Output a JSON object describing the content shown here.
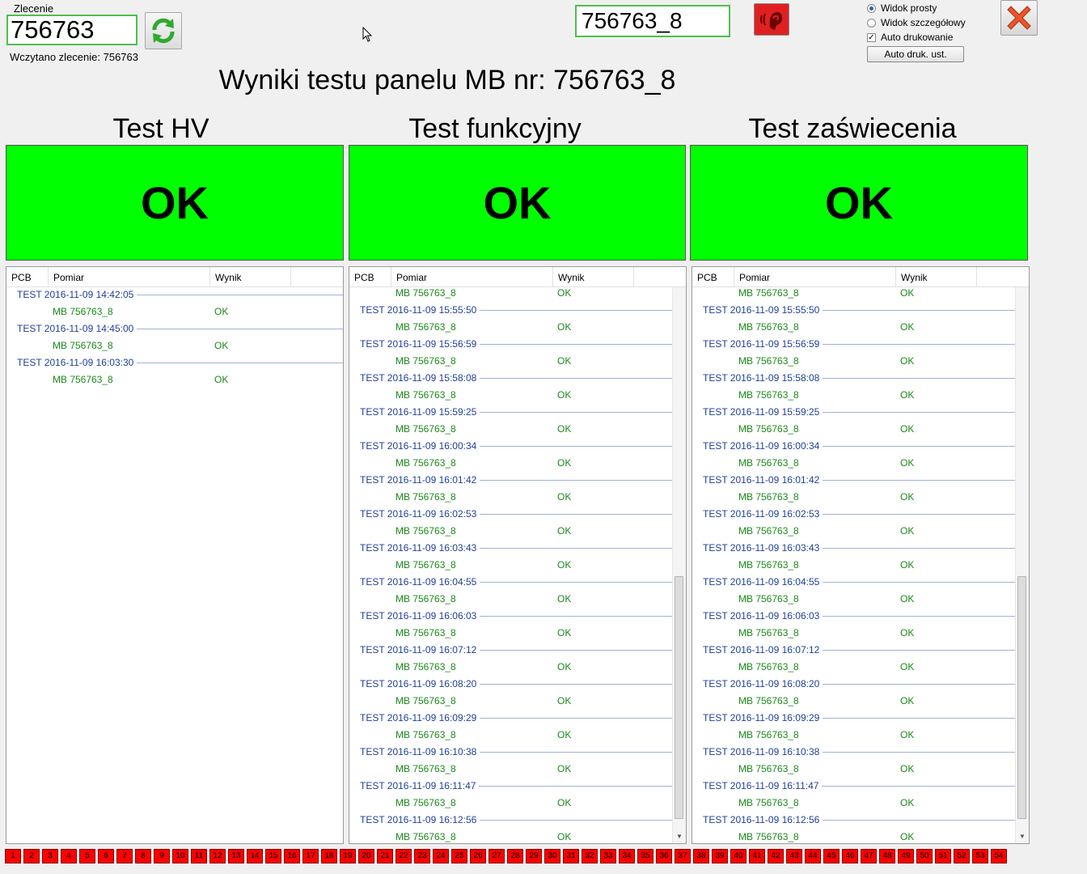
{
  "order": {
    "label": "Zlecenie",
    "value": "756763",
    "loaded_text": "Wczytano zlecenie: 756763"
  },
  "panel_input": {
    "value": "756763_8"
  },
  "options": {
    "simple_view": "Widok prosty",
    "detailed_view": "Widok szczegółowy",
    "auto_print": "Auto drukowanie",
    "auto_print_settings": "Auto druk. ust."
  },
  "title": "Wyniki testu panelu MB nr: 756763_8",
  "columns": [
    {
      "title": "Test HV",
      "status": "OK"
    },
    {
      "title": "Test funkcyjny",
      "status": "OK"
    },
    {
      "title": "Test zaświecenia",
      "status": "OK"
    }
  ],
  "list_headers": {
    "pcb": "PCB",
    "measurement": "Pomiar",
    "result": "Wynik"
  },
  "hv_list": {
    "groups": [
      {
        "label": "TEST 2016-11-09 14:42:05",
        "item": "MB 756763_8",
        "result": "OK"
      },
      {
        "label": "TEST 2016-11-09 14:45:00",
        "item": "MB 756763_8",
        "result": "OK"
      },
      {
        "label": "TEST 2016-11-09 16:03:30",
        "item": "MB 756763_8",
        "result": "OK"
      }
    ]
  },
  "scroll_list": {
    "top_item": "MB 756763_8",
    "top_result": "OK",
    "groups": [
      {
        "label": "TEST 2016-11-09 15:55:50",
        "item": "MB 756763_8",
        "result": "OK"
      },
      {
        "label": "TEST 2016-11-09 15:56:59",
        "item": "MB 756763_8",
        "result": "OK"
      },
      {
        "label": "TEST 2016-11-09 15:58:08",
        "item": "MB 756763_8",
        "result": "OK"
      },
      {
        "label": "TEST 2016-11-09 15:59:25",
        "item": "MB 756763_8",
        "result": "OK"
      },
      {
        "label": "TEST 2016-11-09 16:00:34",
        "item": "MB 756763_8",
        "result": "OK"
      },
      {
        "label": "TEST 2016-11-09 16:01:42",
        "item": "MB 756763_8",
        "result": "OK"
      },
      {
        "label": "TEST 2016-11-09 16:02:53",
        "item": "MB 756763_8",
        "result": "OK"
      },
      {
        "label": "TEST 2016-11-09 16:03:43",
        "item": "MB 756763_8",
        "result": "OK"
      },
      {
        "label": "TEST 2016-11-09 16:04:55",
        "item": "MB 756763_8",
        "result": "OK"
      },
      {
        "label": "TEST 2016-11-09 16:06:03",
        "item": "MB 756763_8",
        "result": "OK"
      },
      {
        "label": "TEST 2016-11-09 16:07:12",
        "item": "MB 756763_8",
        "result": "OK"
      },
      {
        "label": "TEST 2016-11-09 16:08:20",
        "item": "MB 756763_8",
        "result": "OK"
      },
      {
        "label": "TEST 2016-11-09 16:09:29",
        "item": "MB 756763_8",
        "result": "OK"
      },
      {
        "label": "TEST 2016-11-09 16:10:38",
        "item": "MB 756763_8",
        "result": "OK"
      },
      {
        "label": "TEST 2016-11-09 16:11:47",
        "item": "MB 756763_8",
        "result": "OK"
      },
      {
        "label": "TEST 2016-11-09 16:12:56",
        "item": "MB 756763_8",
        "result": "OK"
      }
    ]
  },
  "panel_numbers": [
    "1",
    "2",
    "3",
    "4",
    "5",
    "6",
    "7",
    "8",
    "9",
    "10",
    "11",
    "12",
    "13",
    "14",
    "15",
    "16",
    "17",
    "18",
    "19",
    "20",
    "21",
    "22",
    "23",
    "24",
    "25",
    "26",
    "27",
    "28",
    "29",
    "30",
    "31",
    "32",
    "33",
    "34",
    "35",
    "36",
    "37",
    "38",
    "39",
    "40",
    "41",
    "42",
    "43",
    "44",
    "45",
    "46",
    "47",
    "48",
    "49",
    "50",
    "51",
    "52",
    "53",
    "54"
  ],
  "colors": {
    "ok": "#00ff00",
    "fail": "#ff0000",
    "group_text": "#1f3f9a",
    "item_text": "#1a8a1a"
  }
}
